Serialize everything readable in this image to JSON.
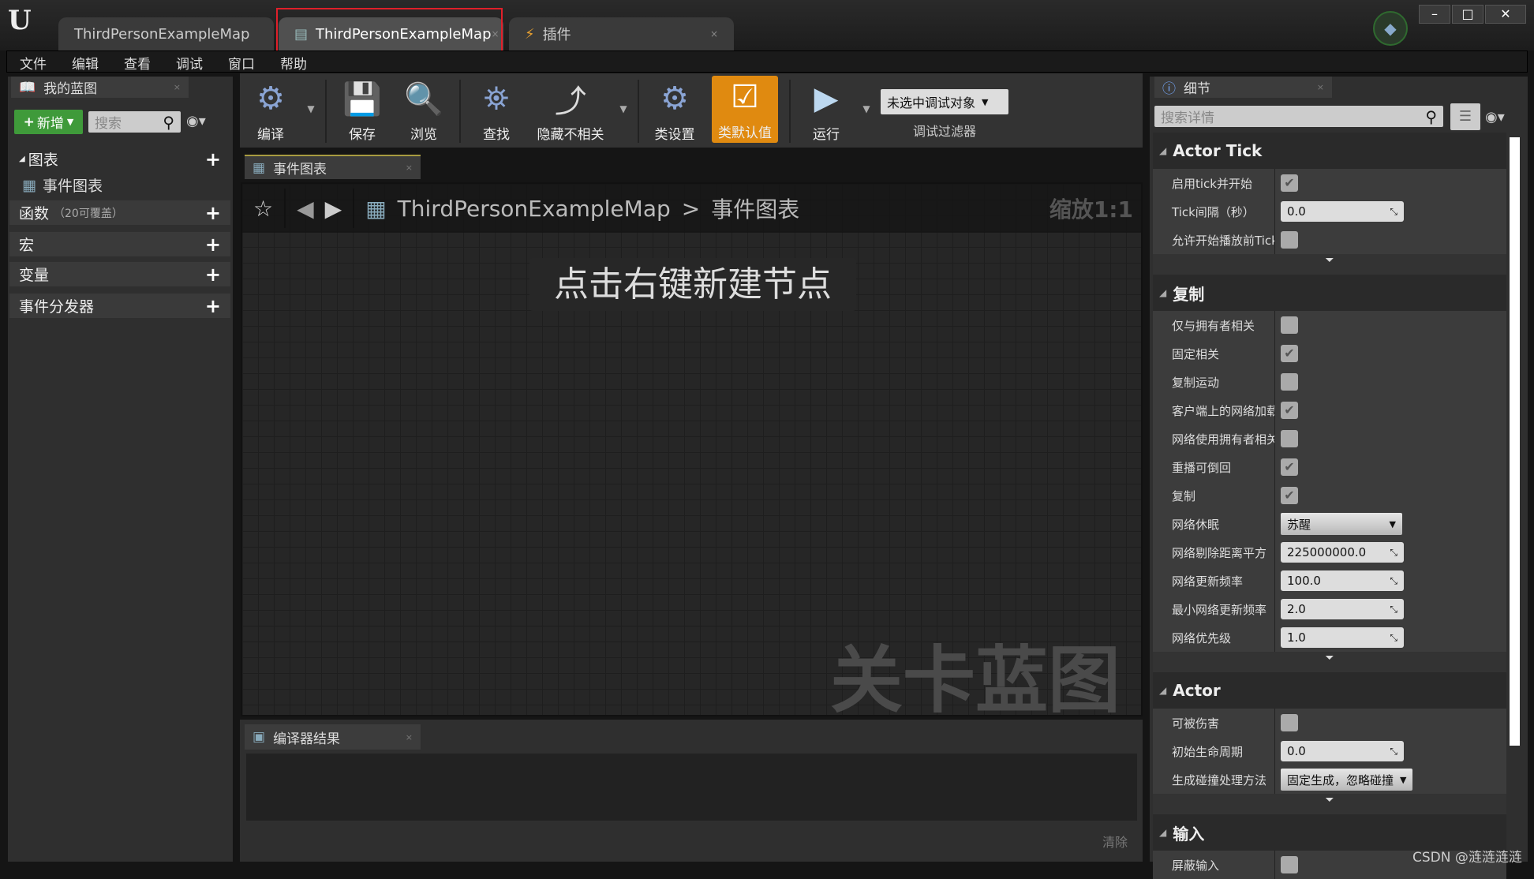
{
  "title_bar": {
    "logo": "U",
    "tabs": [
      {
        "label": "ThirdPersonExampleMap"
      },
      {
        "label": "ThirdPersonExampleMap",
        "close": "×"
      },
      {
        "label": "插件",
        "close": "×"
      }
    ],
    "window_controls": [
      "–",
      "□",
      "✕"
    ]
  },
  "menu": [
    "文件",
    "编辑",
    "查看",
    "调试",
    "窗口",
    "帮助"
  ],
  "my_blueprint": {
    "tab": "我的蓝图",
    "close": "×",
    "new_button": "新增",
    "search_placeholder": "搜索",
    "sections": [
      {
        "label": "图表"
      },
      {
        "label": "函数",
        "note": "（20可覆盖）"
      },
      {
        "label": "宏"
      },
      {
        "label": "变量"
      },
      {
        "label": "事件分发器"
      }
    ],
    "graph_item": "事件图表"
  },
  "toolbar": {
    "compile": "编译",
    "save": "保存",
    "browse": "浏览",
    "find": "查找",
    "hide_unrelated": "隐藏不相关",
    "class_settings": "类设置",
    "class_defaults": "类默认值",
    "play": "运行",
    "debug_object": "未选中调试对象",
    "debug_filter": "调试过滤器"
  },
  "graph": {
    "tab": "事件图表",
    "close": "×",
    "breadcrumb_root": "ThirdPersonExampleMap",
    "breadcrumb_sep": ">",
    "breadcrumb_current": "事件图表",
    "zoom": "缩放1:1",
    "hint": "点击右键新建节点",
    "watermark": "关卡蓝图"
  },
  "compiler": {
    "tab": "编译器结果",
    "close": "×",
    "clear": "清除"
  },
  "details": {
    "tab": "细节",
    "close": "×",
    "search_placeholder": "搜索详情",
    "sections": [
      {
        "title": "Actor Tick",
        "rows": [
          {
            "label": "启用tick并开始",
            "type": "check",
            "checked": true
          },
          {
            "label": "Tick间隔（秒）",
            "type": "num",
            "value": "0.0"
          },
          {
            "label": "允许开始播放前Tick",
            "type": "check",
            "checked": false
          }
        ]
      },
      {
        "title": "复制",
        "rows": [
          {
            "label": "仅与拥有者相关",
            "type": "check",
            "checked": false
          },
          {
            "label": "固定相关",
            "type": "check",
            "checked": true
          },
          {
            "label": "复制运动",
            "type": "check",
            "checked": false
          },
          {
            "label": "客户端上的网络加载",
            "type": "check",
            "checked": true
          },
          {
            "label": "网络使用拥有者相关",
            "type": "check",
            "checked": false
          },
          {
            "label": "重播可倒回",
            "type": "check",
            "checked": true
          },
          {
            "label": "复制",
            "type": "check",
            "checked": true
          },
          {
            "label": "网络休眠",
            "type": "select",
            "value": "苏醒"
          },
          {
            "label": "网络剔除距离平方",
            "type": "num",
            "value": "225000000.0"
          },
          {
            "label": "网络更新频率",
            "type": "num",
            "value": "100.0"
          },
          {
            "label": "最小网络更新频率",
            "type": "num",
            "value": "2.0"
          },
          {
            "label": "网络优先级",
            "type": "num",
            "value": "1.0"
          }
        ]
      },
      {
        "title": "Actor",
        "rows": [
          {
            "label": "可被伤害",
            "type": "check",
            "checked": false
          },
          {
            "label": "初始生命周期",
            "type": "num",
            "value": "0.0"
          },
          {
            "label": "生成碰撞处理方法",
            "type": "select",
            "value": "固定生成，忽略碰撞"
          }
        ]
      },
      {
        "title": "输入",
        "rows": [
          {
            "label": "屏蔽输入",
            "type": "check",
            "checked": false
          }
        ]
      }
    ]
  },
  "watermark": "CSDN @涟涟涟涟",
  "colors": {
    "accent": "#e08a10",
    "new_button": "#3f9a3a",
    "highlight_box": "#e0202a"
  }
}
